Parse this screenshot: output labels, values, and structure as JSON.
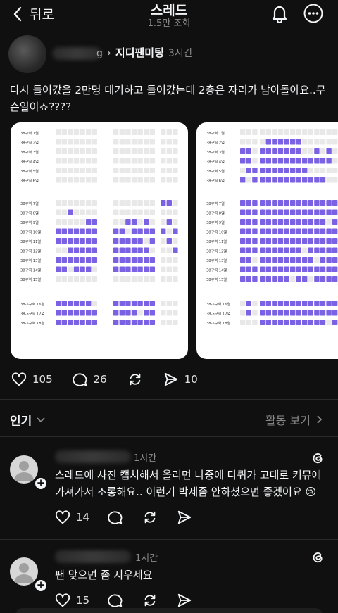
{
  "header": {
    "back_label": "뒤로",
    "title": "스레드",
    "views": "1.5만 조회",
    "icons": [
      "bell-icon",
      "more-icon"
    ]
  },
  "post": {
    "author_partial": "g",
    "community": "지디팬미팅",
    "time": "3시간",
    "text": "다시 들어갔을 2만명 대기하고 들어갔는데 2층은 자리가 남아돌아요..무슨일이죠????",
    "likes": "105",
    "comments": "26",
    "shares": "10"
  },
  "seatmap": {
    "rows_a": [
      "38구역 1열",
      "38구역 2열",
      "38구역 3열",
      "38구역 4열",
      "38구역 5열",
      "38구역 6열"
    ],
    "rows_b": [
      "38구역 7열",
      "38구역 8열",
      "38구역 9열",
      "38구역 10열",
      "38구역 11열",
      "38구역 12열",
      "38구역 13열",
      "38구역 14열",
      "38구역 15열"
    ],
    "rows_c": [
      "38-5구역 16열",
      "38-5구역 17열",
      "38-5구역 18열"
    ],
    "colors": {
      "available": "#7b61e3",
      "taken": "#e8e8e8"
    }
  },
  "sort": {
    "label": "인기",
    "activity_label": "활동 보기"
  },
  "comments": [
    {
      "time": "1시간",
      "text": "스레드에 사진 캡처해서 올리면 나중에 타퀴가 고대로 커뮤에 가져가서 조롱해요.. 이런거 박제좀 안하셨으면 좋겠어요 😢",
      "likes": "14"
    },
    {
      "time": "1시간",
      "text": "팬 맞으면 좀 지우세요",
      "likes": "15"
    }
  ]
}
